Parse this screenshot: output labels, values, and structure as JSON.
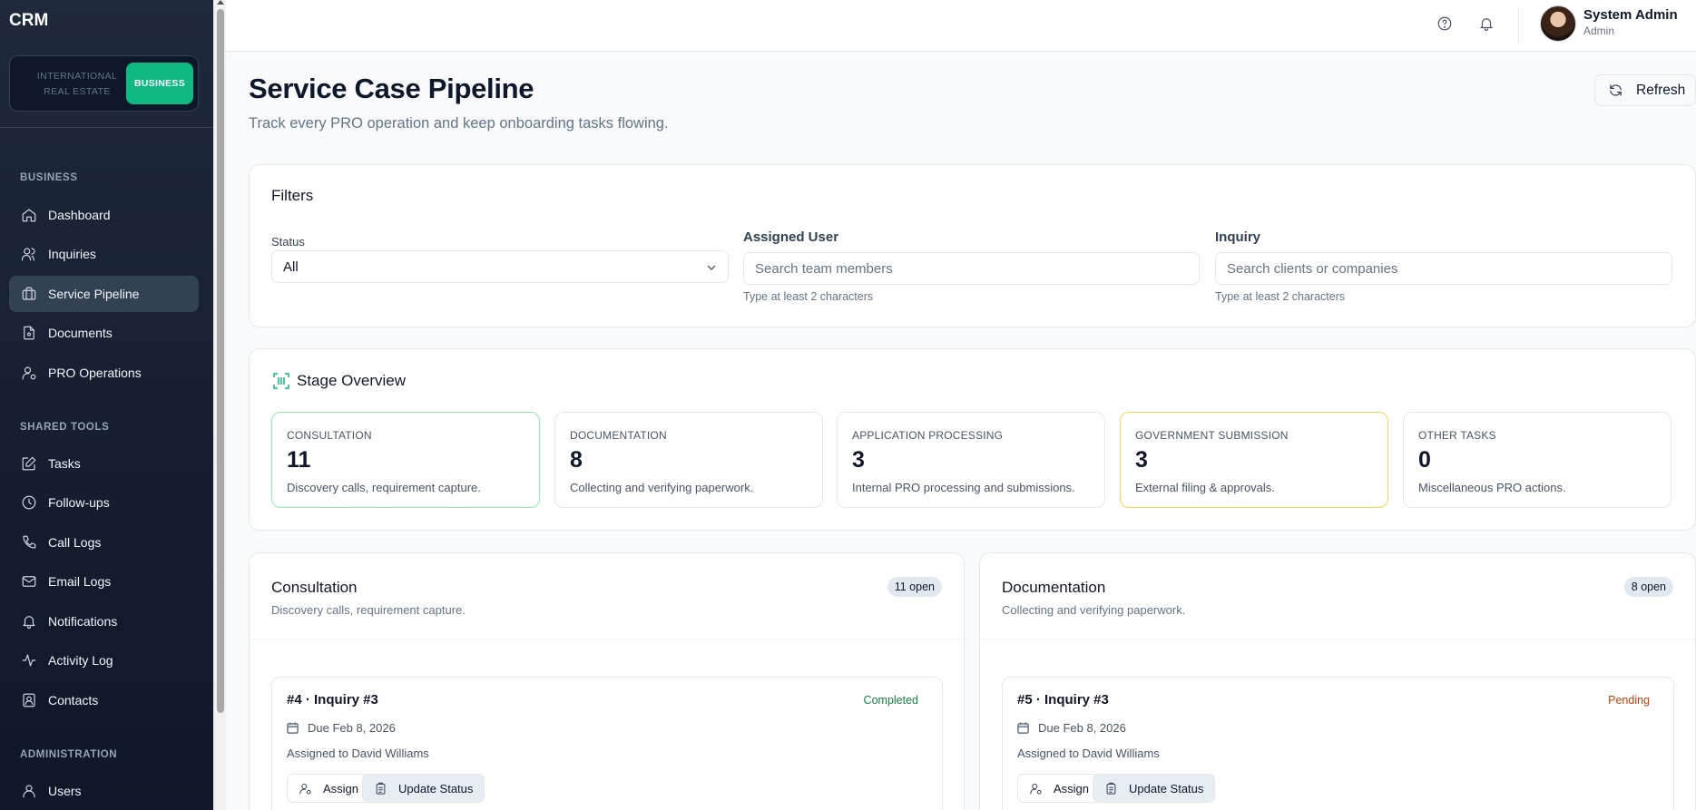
{
  "app": {
    "brand": "CRM"
  },
  "switcher": {
    "inactive_label": "INTERNATIONAL REAL ESTATE",
    "active_label": "BUSINESS"
  },
  "sidebar": {
    "sections": [
      {
        "label": "BUSINESS",
        "items": [
          {
            "label": "Dashboard",
            "icon": "home-icon"
          },
          {
            "label": "Inquiries",
            "icon": "users-icon"
          },
          {
            "label": "Service Pipeline",
            "icon": "briefcase-icon",
            "active": true
          },
          {
            "label": "Documents",
            "icon": "document-icon"
          },
          {
            "label": "PRO Operations",
            "icon": "user-cog-icon"
          }
        ]
      },
      {
        "label": "SHARED TOOLS",
        "items": [
          {
            "label": "Tasks",
            "icon": "edit-icon"
          },
          {
            "label": "Follow-ups",
            "icon": "clock-icon"
          },
          {
            "label": "Call Logs",
            "icon": "phone-icon"
          },
          {
            "label": "Email Logs",
            "icon": "mail-icon"
          },
          {
            "label": "Notifications",
            "icon": "bell-icon"
          },
          {
            "label": "Activity Log",
            "icon": "activity-icon"
          },
          {
            "label": "Contacts",
            "icon": "contact-icon"
          }
        ]
      },
      {
        "label": "ADMINISTRATION",
        "items": [
          {
            "label": "Users",
            "icon": "user-icon"
          }
        ]
      }
    ]
  },
  "header": {
    "user_name": "System Admin",
    "user_role": "Admin"
  },
  "page": {
    "title": "Service Case Pipeline",
    "subtitle": "Track every PRO operation and keep onboarding tasks flowing.",
    "refresh_label": "Refresh"
  },
  "filters": {
    "title": "Filters",
    "status_label": "Status",
    "status_value": "All",
    "assigned_label": "Assigned User",
    "assigned_placeholder": "Search team members",
    "assigned_hint": "Type at least 2 characters",
    "inquiry_label": "Inquiry",
    "inquiry_placeholder": "Search clients or companies",
    "inquiry_hint": "Type at least 2 characters"
  },
  "stages": {
    "title": "Stage Overview",
    "items": [
      {
        "label": "CONSULTATION",
        "value": "11",
        "desc": "Discovery calls, requirement capture.",
        "accent": "#86efac"
      },
      {
        "label": "DOCUMENTATION",
        "value": "8",
        "desc": "Collecting and verifying paperwork.",
        "accent": "#e5e7eb"
      },
      {
        "label": "APPLICATION PROCESSING",
        "value": "3",
        "desc": "Internal PRO processing and submissions.",
        "accent": "#e5e7eb"
      },
      {
        "label": "GOVERNMENT SUBMISSION",
        "value": "3",
        "desc": "External filing & approvals.",
        "accent": "#fcd34d"
      },
      {
        "label": "OTHER TASKS",
        "value": "0",
        "desc": "Miscellaneous PRO actions.",
        "accent": "#e5e7eb"
      }
    ]
  },
  "columns": [
    {
      "title": "Consultation",
      "subtitle": "Discovery calls, requirement capture.",
      "badge": "11 open",
      "task": {
        "title": "#4 · Inquiry #3",
        "status": "Completed",
        "status_color": "#15803d",
        "due": "Due Feb 8, 2026",
        "assigned": "Assigned to David Williams",
        "assign_label": "Assign",
        "update_label": "Update Status"
      }
    },
    {
      "title": "Documentation",
      "subtitle": "Collecting and verifying paperwork.",
      "badge": "8 open",
      "task": {
        "title": "#5 · Inquiry #3",
        "status": "Pending",
        "status_color": "#c2410c",
        "due": "Due Feb 8, 2026",
        "assigned": "Assigned to David Williams",
        "assign_label": "Assign",
        "update_label": "Update Status"
      }
    }
  ]
}
